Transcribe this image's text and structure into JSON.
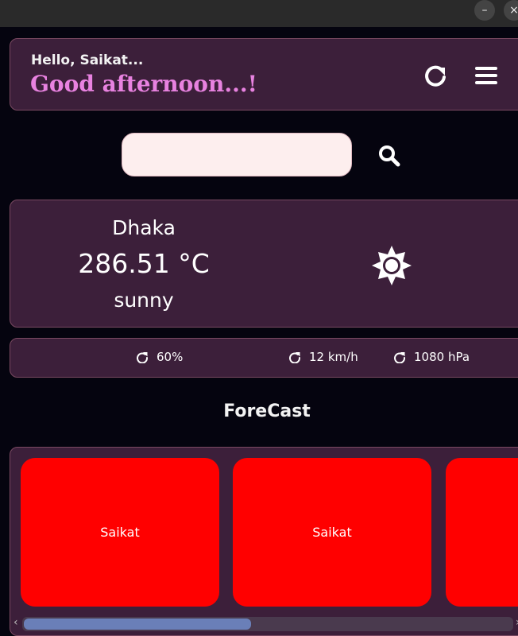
{
  "window": {
    "minimize_symbol": "–",
    "close_symbol": "×"
  },
  "header": {
    "greeting": "Hello, Saikat...",
    "salutation": "Good afternoon...!",
    "refresh_icon": "refresh-icon",
    "menu_icon": "hamburger-menu-icon"
  },
  "search": {
    "value": "",
    "placeholder": "",
    "icon": "search-icon"
  },
  "weather": {
    "city": "Dhaka",
    "temperature": "286.51  °C",
    "condition": "sunny",
    "icon": "sun-icon"
  },
  "stats": {
    "humidity": "60%",
    "wind": "12 km/h",
    "pressure": "1080 hPa"
  },
  "forecast": {
    "title": "ForeCast",
    "items": [
      {
        "label": "Saikat"
      },
      {
        "label": "Saikat"
      },
      {
        "label": ""
      }
    ],
    "scroll_left": "‹",
    "scroll_right": "›"
  },
  "colors": {
    "background": "#05040f",
    "card": "#3c1f3a",
    "accent": "#e882e0",
    "forecast_card": "#ff0000",
    "search_bg": "#fdeeee"
  }
}
